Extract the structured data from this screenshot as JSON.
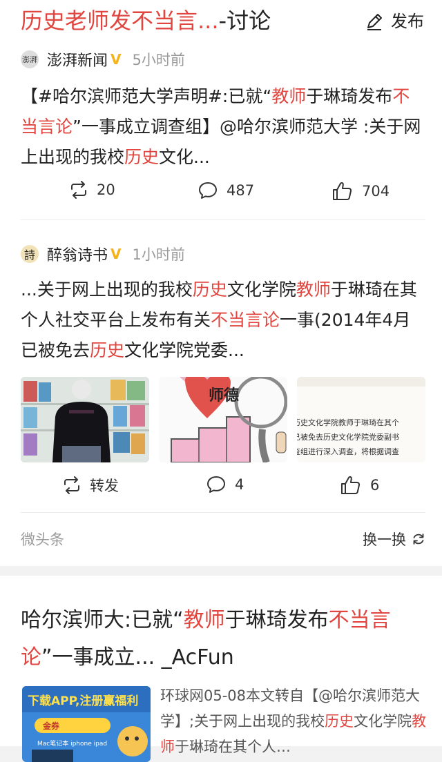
{
  "topic": {
    "title_a": "历史老师发不当言...",
    "title_b": "-讨论",
    "publish_label": "发布"
  },
  "posts": [
    {
      "avatar_text": "澎湃",
      "author": "澎湃新闻",
      "badge": "V",
      "time": "5小时前",
      "body": [
        {
          "t": "【#哈尔滨师范大学声明#:已就“",
          "hl": false
        },
        {
          "t": "教师",
          "hl": true
        },
        {
          "t": "于琳琦发布",
          "hl": false
        },
        {
          "t": "不当言论",
          "hl": true
        },
        {
          "t": "”一事成立调查组】@哈尔滨师范大学 :关于网上出现的我校",
          "hl": false
        },
        {
          "t": "历史",
          "hl": true
        },
        {
          "t": "文化...",
          "hl": false
        }
      ],
      "repost": "20",
      "comments": "487",
      "likes": "704"
    },
    {
      "avatar_text": "詩",
      "author": "醉翁诗书",
      "badge": "V",
      "time": "1小时前",
      "body": [
        {
          "t": "...关于网上出现的我校",
          "hl": false
        },
        {
          "t": "历史",
          "hl": true
        },
        {
          "t": "文化学院",
          "hl": false
        },
        {
          "t": "教师",
          "hl": true
        },
        {
          "t": "于琳琦在其个人社交平台上发布有关",
          "hl": false
        },
        {
          "t": "不当言论",
          "hl": true
        },
        {
          "t": "一事(2014年4月已被免去",
          "hl": false
        },
        {
          "t": "历史",
          "hl": true
        },
        {
          "t": "文化学院党委...",
          "hl": false
        }
      ],
      "images": {
        "img2_text": "师德",
        "img3_lines": [
          "历史文化学院教师于琳琦在其个",
          "已被免去历史文化学院党委副书",
          "查组进行深入调查，将根据调查"
        ]
      },
      "repost": "转发",
      "comments": "4",
      "likes": "6"
    }
  ],
  "footer": {
    "source": "微头条",
    "refresh": "换一换"
  },
  "article": {
    "title": [
      {
        "t": "哈尔滨师大:已就“",
        "hl": false
      },
      {
        "t": "教师",
        "hl": true
      },
      {
        "t": "于琳琦发布",
        "hl": false
      },
      {
        "t": "不当言论",
        "hl": true
      },
      {
        "t": "”一事成立... _AcFun",
        "hl": false
      }
    ],
    "snippet": [
      {
        "t": "环球网05-08本文转自【@哈尔滨师范大学】;关于网上出现的我校",
        "hl": false
      },
      {
        "t": "历史",
        "hl": true
      },
      {
        "t": "文化学院",
        "hl": false
      },
      {
        "t": "教师",
        "hl": true
      },
      {
        "t": "于琳琦在其个人…",
        "hl": false
      }
    ],
    "thumb_banner": "下载APP,注册赢福利",
    "thumb_sub": "Mac笔记本 iphone ipad",
    "thumb_badge": "金券"
  },
  "colors": {
    "highlight": "#e0463f",
    "verified": "#f5b21b"
  }
}
